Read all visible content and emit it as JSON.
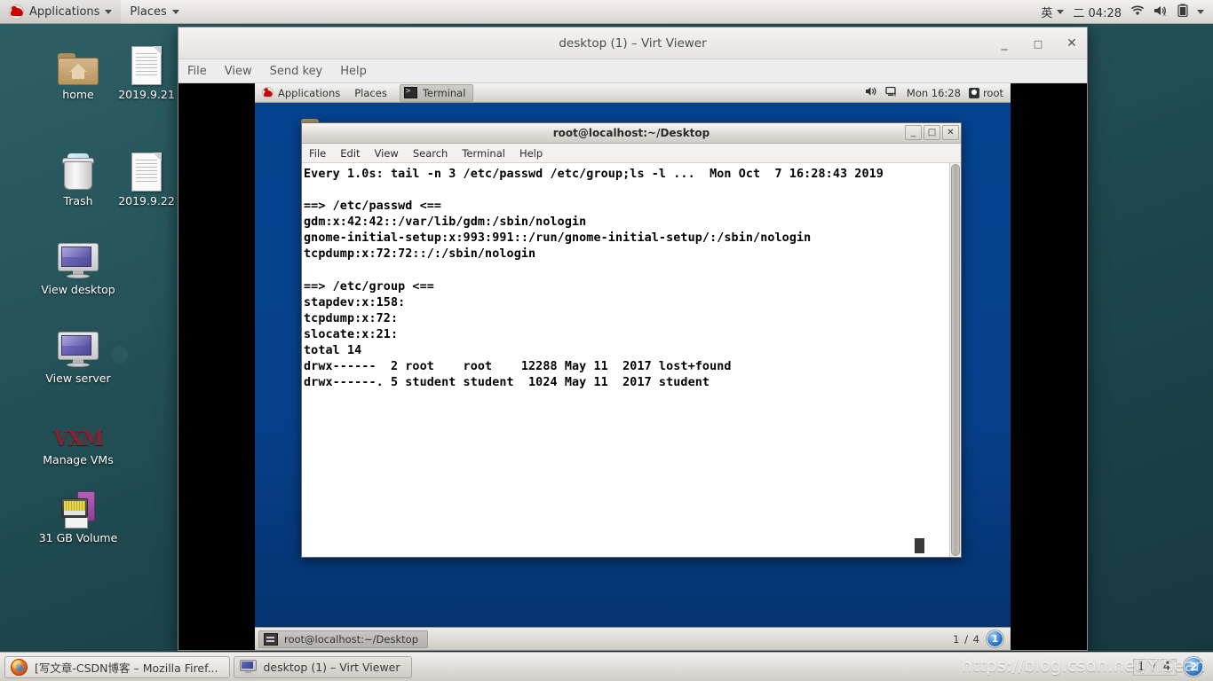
{
  "host_panel": {
    "applications_label": "Applications",
    "places_label": "Places",
    "input_method": "英",
    "clock": "二 04:28",
    "icons": {
      "logo": "redhat-logo-icon",
      "network": "wifi-icon",
      "volume": "volume-muted-icon",
      "battery": "battery-icon",
      "caret": "chevron-down-icon"
    }
  },
  "desktop_icons": [
    {
      "label": "home",
      "icon": "home-folder-icon"
    },
    {
      "label": "2019.9.21",
      "icon": "document-icon"
    },
    {
      "label": "Trash",
      "icon": "trash-icon"
    },
    {
      "label": "2019.9.22",
      "icon": "document-icon"
    },
    {
      "label": "View desktop",
      "icon": "monitor-icon"
    },
    {
      "label": "View server",
      "icon": "monitor-icon"
    },
    {
      "label": "Manage VMs",
      "icon": "vmm-logo-icon"
    },
    {
      "label": "31 GB Volume",
      "icon": "drive-volume-icon"
    }
  ],
  "virt_viewer": {
    "title": "desktop (1) – Virt Viewer",
    "menus": [
      "File",
      "View",
      "Send key",
      "Help"
    ],
    "window_buttons": {
      "minimize": "_",
      "maximize": "□",
      "close": "✕"
    }
  },
  "guest": {
    "top_panel": {
      "applications_label": "Applications",
      "places_label": "Places",
      "active_task": "Terminal",
      "clock": "Mon 16:28",
      "user": "root"
    },
    "bottom_panel": {
      "task_button": "root@localhost:~/Desktop",
      "workspace_count": "1 / 4",
      "workspace_current": "1"
    }
  },
  "terminal": {
    "title": "root@localhost:~/Desktop",
    "menus": [
      "File",
      "Edit",
      "View",
      "Search",
      "Terminal",
      "Help"
    ],
    "window_buttons": {
      "minimize": "_",
      "maximize": "□",
      "close": "✕"
    },
    "content": "Every 1.0s: tail -n 3 /etc/passwd /etc/group;ls -l ...  Mon Oct  7 16:28:43 2019\n\n==> /etc/passwd <==\ngdm:x:42:42::/var/lib/gdm:/sbin/nologin\ngnome-initial-setup:x:993:991::/run/gnome-initial-setup/:/sbin/nologin\ntcpdump:x:72:72::/:/sbin/nologin\n\n==> /etc/group <==\nstapdev:x:158:\ntcpdump:x:72:\nslocate:x:21:\ntotal 14\ndrwx------  2 root    root    12288 May 11  2017 lost+found\ndrwx------. 5 student student  1024 May 11  2017 student"
  },
  "host_taskbar": {
    "buttons": [
      {
        "label": "[写文章-CSDN博客 – Mozilla Firef...",
        "icon": "firefox-icon",
        "active": false
      },
      {
        "label": "desktop (1) – Virt Viewer",
        "icon": "virt-viewer-icon",
        "active": true
      }
    ],
    "workspace_count": "1 / 4",
    "workspace_current": "2"
  },
  "watermark": "https://blog.csdn.net/YiSean",
  "colors": {
    "guest_desktop_blue": "#05408c",
    "host_wallpaper_teal": "#1e4a4f",
    "panel_grey": "#e3e1de",
    "accent_blue": "#2a78c8"
  }
}
